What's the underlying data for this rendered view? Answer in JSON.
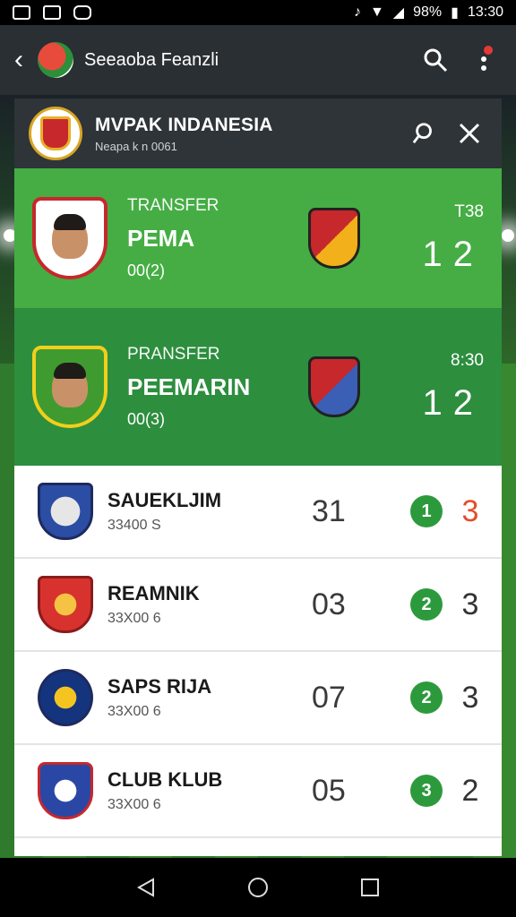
{
  "status_bar": {
    "battery": "98%",
    "time": "13:30"
  },
  "app_bar": {
    "title": "Seeaoba Feanzli",
    "back_icon": "back-arrow-icon",
    "search_icon": "search-icon",
    "menu_icon": "more-vert-icon"
  },
  "card_header": {
    "title": "MVPAK INDANESIA",
    "subtitle": "Neapa k n 0061"
  },
  "transfers": [
    {
      "label": "TRANSFER",
      "name": "PEMA",
      "code": "00(2)",
      "time": "T38",
      "score_home": "1",
      "score_away": "2"
    },
    {
      "label": "PRANSFER",
      "name": "PEEMARIN",
      "code": "00(3)",
      "time": "8:30",
      "score_home": "1",
      "score_away": "2"
    }
  ],
  "rows": [
    {
      "name": "SAUEKLJIM",
      "sub": "33400 S",
      "num": "31",
      "badge": "1",
      "score": "3",
      "score_color": "#e24d2c"
    },
    {
      "name": "REAMNIK",
      "sub": "33X00 6",
      "num": "03",
      "badge": "2",
      "score": "3"
    },
    {
      "name": "SAPS RIJA",
      "sub": "33X00 6",
      "num": "07",
      "badge": "2",
      "score": "3"
    },
    {
      "name": "CLUB KLUB",
      "sub": "33X00 6",
      "num": "05",
      "badge": "3",
      "score": "2"
    }
  ],
  "colors": {
    "primary_green": "#45ad44",
    "dark_green": "#2d8e3e",
    "app_bar": "#2a2f33",
    "accent_red": "#e24d2c"
  }
}
